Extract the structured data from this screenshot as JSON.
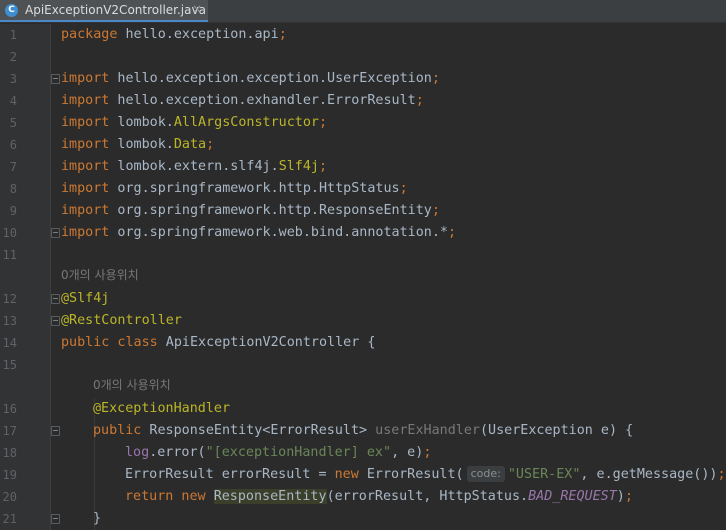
{
  "tab": {
    "file_name": "ApiExceptionV2Controller.java",
    "close_glyph": "×",
    "icon_letter": "C"
  },
  "gutter": {
    "line_numbers": [
      "1",
      "2",
      "3",
      "4",
      "5",
      "6",
      "7",
      "8",
      "9",
      "10",
      "11",
      "12",
      "13",
      "14",
      "15",
      "16",
      "17",
      "18",
      "19",
      "20",
      "21"
    ]
  },
  "code": {
    "l1": {
      "kw": "package",
      "pkg": " hello.exception.api",
      "semi": ";"
    },
    "l3": {
      "kw": "import",
      "path": " hello.exception.exception.UserException",
      "semi": ";"
    },
    "l4": {
      "kw": "import",
      "path": " hello.exception.exhandler.ErrorResult",
      "semi": ";"
    },
    "l5": {
      "kw": "import",
      "path": " lombok.",
      "ann": "AllArgsConstructor",
      "semi": ";"
    },
    "l6": {
      "kw": "import",
      "path": " lombok.",
      "ann": "Data",
      "semi": ";"
    },
    "l7": {
      "kw": "import",
      "path": " lombok.extern.slf4j.",
      "ann": "Slf4j",
      "semi": ";"
    },
    "l8": {
      "kw": "import",
      "path": " org.springframework.http.HttpStatus",
      "semi": ";"
    },
    "l9": {
      "kw": "import",
      "path": " org.springframework.http.ResponseEntity",
      "semi": ";"
    },
    "l10": {
      "kw": "import",
      "path": " org.springframework.web.bind.annotation.*",
      "semi": ";"
    },
    "hint1": "0개의 사용위치",
    "l12": {
      "ann": "@Slf4j"
    },
    "l13": {
      "ann": "@RestController"
    },
    "l14": {
      "kw": "public class",
      "rest": " ApiExceptionV2Controller {"
    },
    "hint2": "0개의 사용위치",
    "l16": {
      "ann": "@ExceptionHandler"
    },
    "l17": {
      "kw": "public",
      "type": " ResponseEntity<ErrorResult> ",
      "method": "userExHandler",
      "params": "(UserException e) {"
    },
    "l18": {
      "field": "log",
      "call": ".error(",
      "str": "\"[exceptionHandler] ex\"",
      "rest": ", e)",
      "semi": ";"
    },
    "l19": {
      "decl": "ErrorResult errorResult = ",
      "kw": "new",
      "ctor": " ErrorResult(",
      "param_hint": "code:",
      "str": "\"USER-EX\"",
      "rest": ", e.getMessage())",
      "semi": ";"
    },
    "l20": {
      "kw": "return new",
      "sp": " ",
      "cls": "ResponseEntity",
      "args": "(errorResult, HttpStatus.",
      "enum": "BAD_REQUEST",
      "close": ")",
      "semi": ";"
    },
    "l21": {
      "brace": "}"
    }
  }
}
